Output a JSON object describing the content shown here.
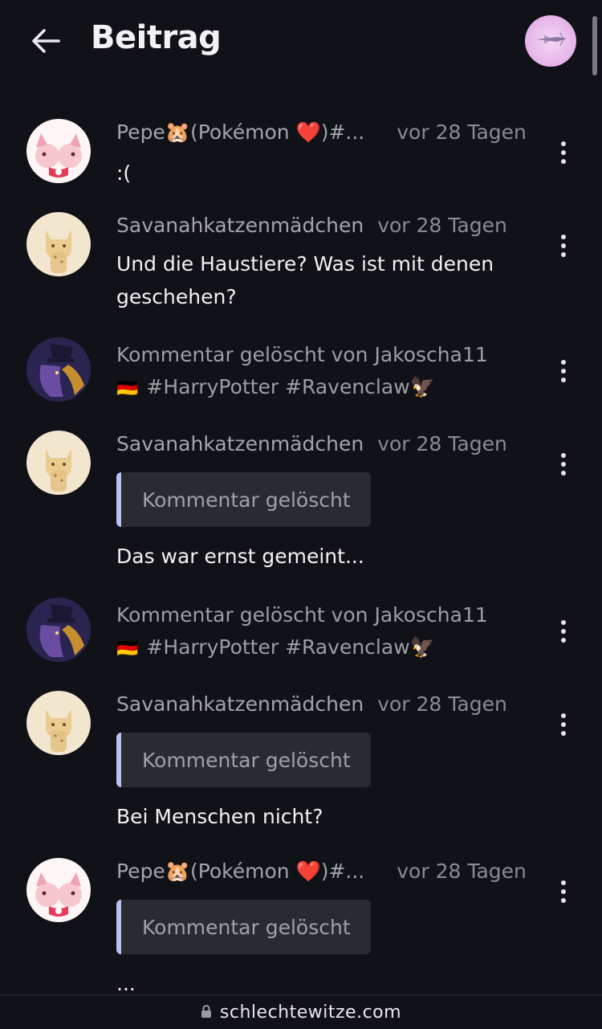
{
  "header": {
    "title": "Beitrag"
  },
  "comments": [
    {
      "author": "Pepe🐹(Pokémon ❤️)#...",
      "time": "vor 28 Tagen",
      "text": ":(",
      "avatar": "pink-pokemon-avatar"
    },
    {
      "author": "Savanahkatzenmädchen",
      "time": "vor 28 Tagen",
      "text_line1": "Und die Haustiere? Was ist mit denen",
      "text_line2": "geschehen?",
      "avatar": "cream-cat-avatar"
    },
    {
      "deleted_line1": "Kommentar gelöscht von Jakoscha11",
      "deleted_flag": "🇩🇪",
      "deleted_line2": "#HarryPotter #Ravenclaw🦅",
      "avatar": "dark-wizard-avatar"
    },
    {
      "author": "Savanahkatzenmädchen",
      "time": "vor 28 Tagen",
      "quote": "Kommentar gelöscht",
      "text": "Das war ernst gemeint...",
      "avatar": "cream-cat-avatar"
    },
    {
      "deleted_line1": "Kommentar gelöscht von Jakoscha11",
      "deleted_flag": "🇩🇪",
      "deleted_line2": "#HarryPotter #Ravenclaw🦅",
      "avatar": "dark-wizard-avatar"
    },
    {
      "author": "Savanahkatzenmädchen",
      "time": "vor 28 Tagen",
      "quote": "Kommentar gelöscht",
      "text": "Bei Menschen nicht?",
      "avatar": "cream-cat-avatar"
    },
    {
      "author": "Pepe🐹(Pokémon ❤️)#...",
      "time": "vor 28 Tagen",
      "quote": "Kommentar gelöscht",
      "text": "...",
      "avatar": "pink-pokemon-avatar"
    }
  ],
  "browser": {
    "url": "schlechtewitze.com",
    "lock_icon": "lock-icon"
  },
  "colors": {
    "background": "#111118",
    "quote_accent": "#b8c2f5",
    "muted_text": "#a4a4ad"
  }
}
